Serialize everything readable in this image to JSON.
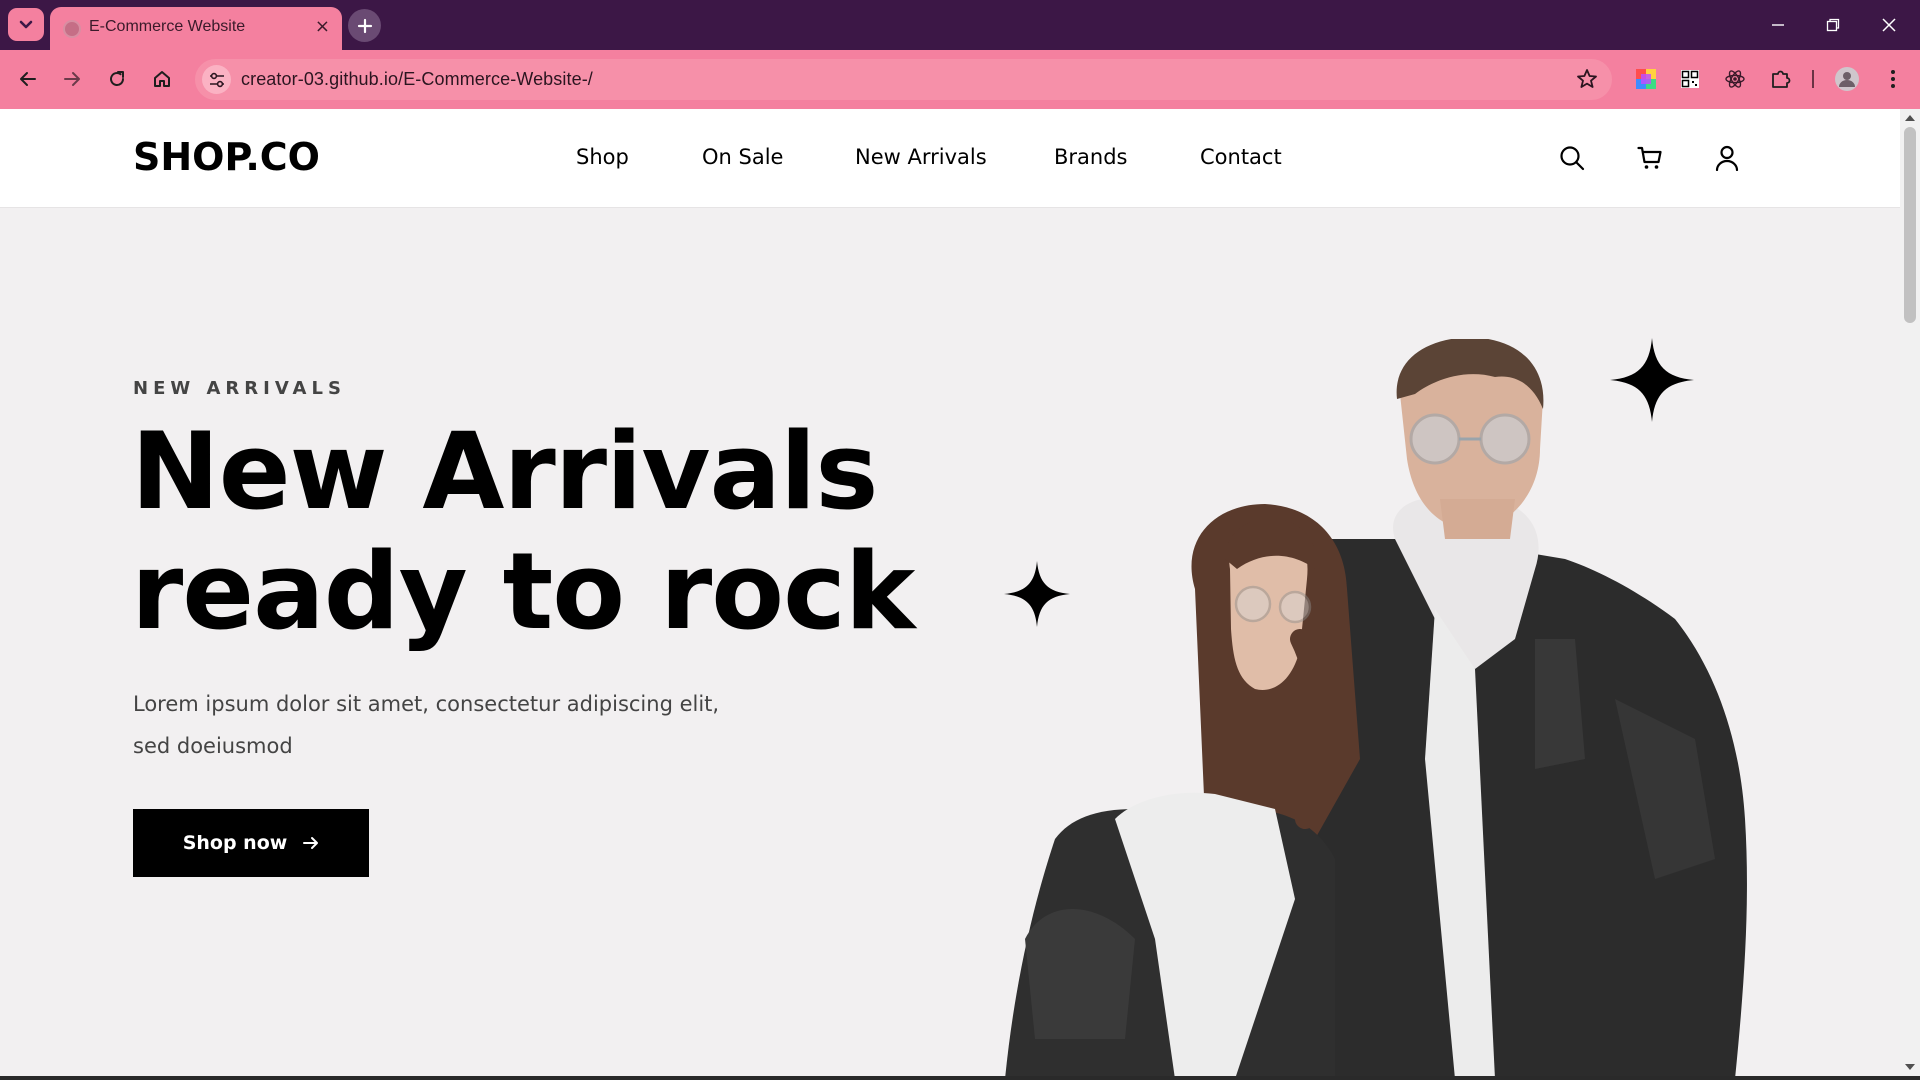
{
  "browser": {
    "tab_title": "E-Commerce Website",
    "tab_close": "×",
    "url": "creator-03.github.io/E-Commerce-Website-/",
    "icons": {
      "tab_search": "chevron-down-icon",
      "new_tab": "plus-icon",
      "minimize": "minimize-icon",
      "restore": "restore-icon",
      "close": "close-icon",
      "back": "arrow-left-icon",
      "forward": "arrow-right-icon",
      "reload": "reload-icon",
      "home": "home-icon",
      "site_info": "tune-icon",
      "bookmark": "star-icon",
      "extensions": [
        "color-picker-icon",
        "qr-code-icon",
        "react-icon",
        "puzzle-icon"
      ],
      "profile": "avatar-icon",
      "menu": "kebab-menu-icon"
    },
    "colors": {
      "tabstrip": "#3c1746",
      "toolbar": "#f4809f"
    }
  },
  "header": {
    "logo": "SHOP.CO",
    "nav": [
      "Shop",
      "On Sale",
      "New Arrivals",
      "Brands",
      "Contact"
    ],
    "icons": [
      "search-icon",
      "cart-icon",
      "user-icon"
    ]
  },
  "hero": {
    "eyebrow": "NEW ARRIVALS",
    "headline_line1": "New Arrivals",
    "headline_line2": "ready to rock",
    "description": "Lorem ipsum dolor sit amet, consectetur adipiscing elit, sed doeiusmod",
    "cta_label": "Shop now",
    "cta_icon": "arrow-right-icon",
    "colors": {
      "background": "#f2f0f1",
      "cta": "#000000"
    }
  }
}
